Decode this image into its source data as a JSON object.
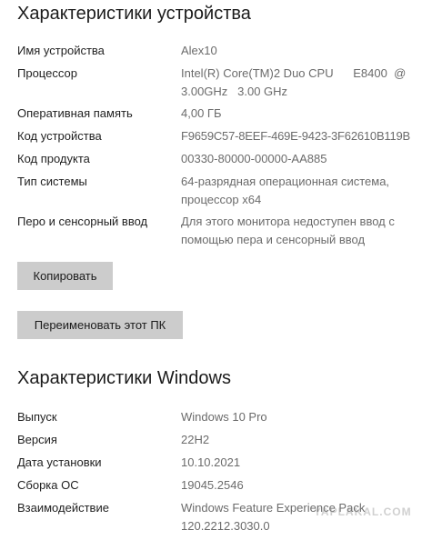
{
  "device_specs": {
    "heading": "Характеристики устройства",
    "rows": [
      {
        "label": "Имя устройства",
        "value": "Alex10"
      },
      {
        "label": "Процессор",
        "value": "Intel(R) Core(TM)2 Duo CPU      E8400  @\n3.00GHz   3.00 GHz"
      },
      {
        "label": "Оперативная память",
        "value": "4,00 ГБ"
      },
      {
        "label": "Код устройства",
        "value": "F9659C57-8EEF-469E-9423-3F62610B119B"
      },
      {
        "label": "Код продукта",
        "value": "00330-80000-00000-AA885"
      },
      {
        "label": "Тип системы",
        "value": "64-разрядная операционная система,\nпроцессор x64"
      },
      {
        "label": "Перо и сенсорный ввод",
        "value": "Для этого монитора недоступен ввод с\nпомощью пера и сенсорный ввод"
      }
    ],
    "copy_button": "Копировать",
    "rename_button": "Переименовать этот ПК"
  },
  "windows_specs": {
    "heading": "Характеристики Windows",
    "rows": [
      {
        "label": "Выпуск",
        "value": "Windows 10 Pro"
      },
      {
        "label": "Версия",
        "value": "22H2"
      },
      {
        "label": "Дата установки",
        "value": "10.10.2021"
      },
      {
        "label": "Сборка ОС",
        "value": "19045.2546"
      },
      {
        "label": "Взаимодействие",
        "value": "Windows Feature Experience Pack\n120.2212.3030.0"
      }
    ]
  },
  "watermark": "YAPLAKAL.COM"
}
